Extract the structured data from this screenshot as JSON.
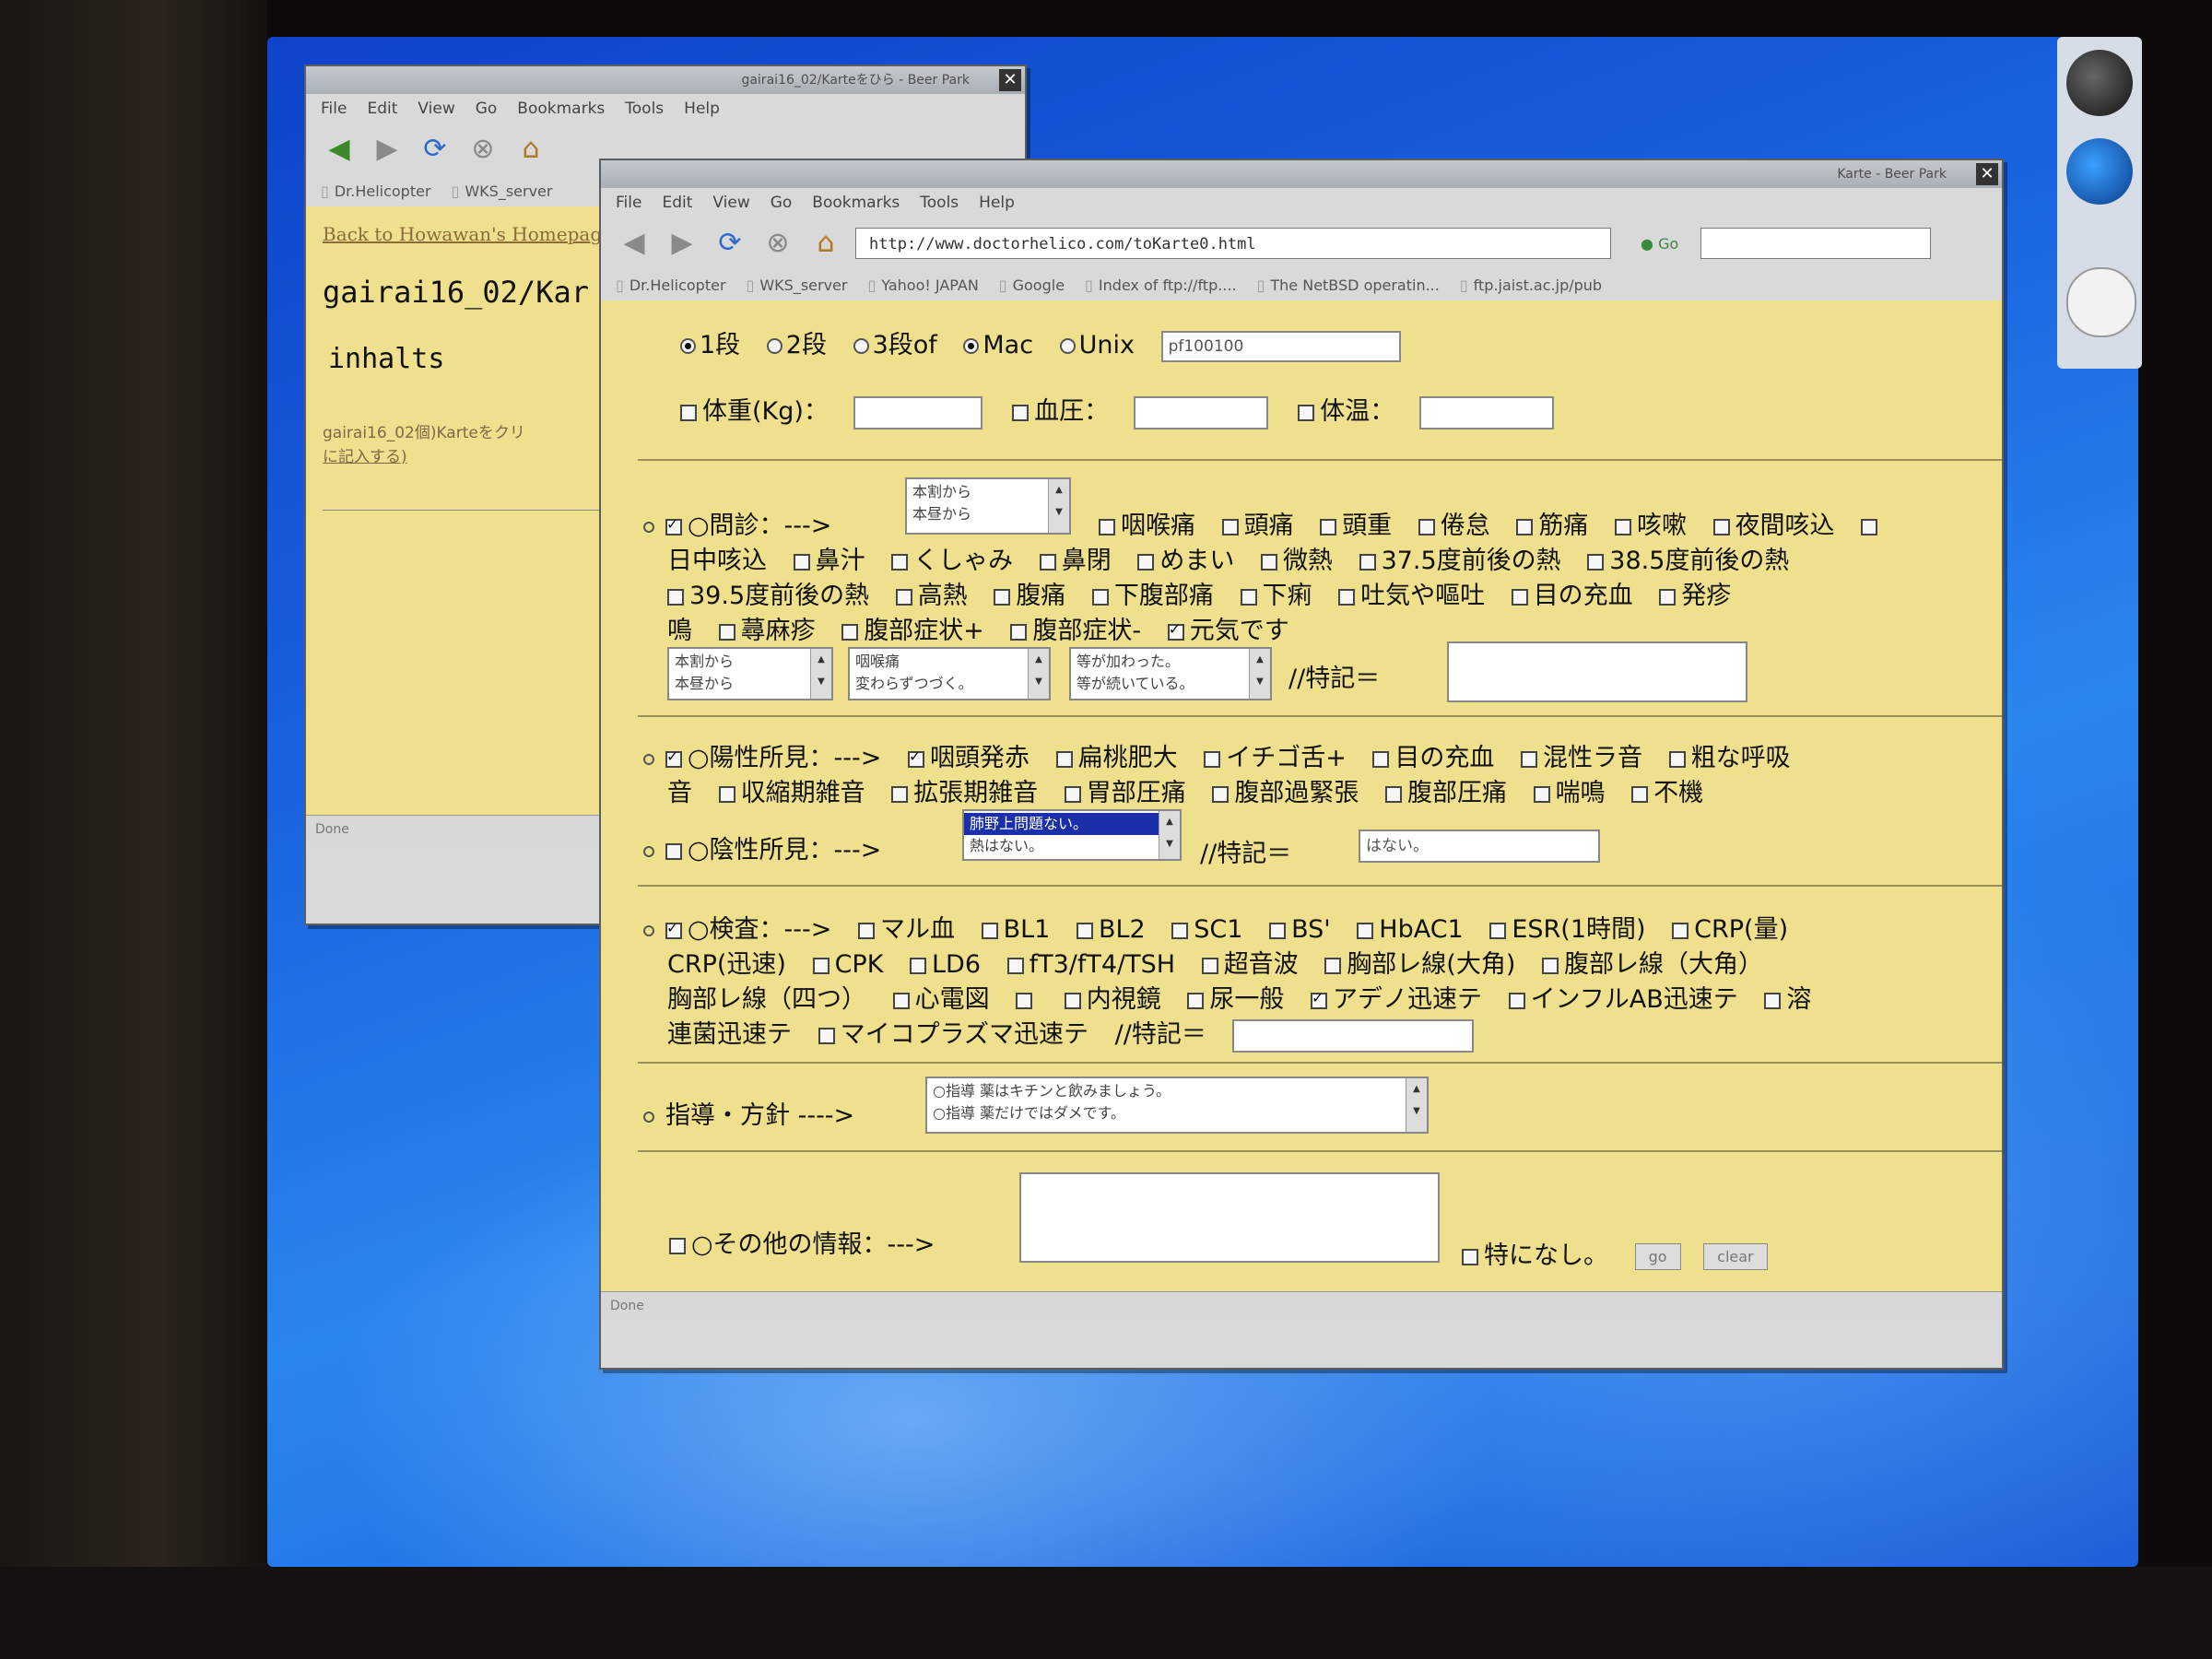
{
  "back_window": {
    "title": "gairai16_02/Karteをひら - Beer Park",
    "menu": [
      "File",
      "Edit",
      "View",
      "Go",
      "Bookmarks",
      "Tools",
      "Help"
    ],
    "bookmarks": [
      "Dr.Helicopter",
      "WKS_server"
    ],
    "link_home": "Back to Howawan's Homepage",
    "heading": "gairai16_02/Kar",
    "heading2": "inhalts",
    "small_text_1": "gairai16_02個)Karteをクリ",
    "small_text_2": "に記入する)",
    "status": "Done"
  },
  "front_window": {
    "title": "Karte - Beer Park",
    "menu": [
      "File",
      "Edit",
      "View",
      "Go",
      "Bookmarks",
      "Tools",
      "Help"
    ],
    "url": "http://www.doctorhelico.com/toKarte0.html",
    "go_label": "Go",
    "bookmarks": [
      "Dr.Helicopter",
      "WKS_server",
      "Yahoo! JAPAN",
      "Google",
      "Index of ftp://ftp....",
      "The NetBSD operatin...",
      "ftp.jaist.ac.jp/pub"
    ],
    "status": "Done"
  },
  "form": {
    "radios": [
      {
        "label": "1段",
        "checked": true
      },
      {
        "label": "2段",
        "checked": false
      },
      {
        "label": "3段of",
        "checked": false
      },
      {
        "label": "Mac",
        "checked": true
      },
      {
        "label": "Unix",
        "checked": false
      }
    ],
    "code_value": "pf100100",
    "vitals": [
      "体重(Kg)：",
      "血圧：",
      "体温："
    ],
    "monshin_label": "○問診：--->",
    "monshin_list": [
      "本割から",
      "本昼から"
    ],
    "monshin_line1": [
      "咽喉痛",
      "頭痛",
      "頭重",
      "倦怠",
      "筋痛",
      "咳嗽",
      "夜間咳込"
    ],
    "monshin_line2": [
      "日中咳込",
      "鼻汁",
      "くしゃみ",
      "鼻閉",
      "めまい",
      "微熱",
      "37.5度前後の熱",
      "38.5度前後の熱"
    ],
    "monshin_line3": [
      "39.5度前後の熱",
      "高熱",
      "腹痛",
      "下腹部痛",
      "下痢",
      "吐気や嘔吐",
      "目の充血",
      "発疹"
    ],
    "monshin_line4_lead": "鳴",
    "monshin_line4": [
      "蕁麻疹",
      "腹部症状+",
      "腹部症状-"
    ],
    "monshin_ok": "元気です",
    "sel1": [
      "本割から",
      "本昼から"
    ],
    "sel2": [
      "咽喉痛",
      "変わらずつづく。"
    ],
    "sel3": [
      "等が加わった。",
      "等が続いている。"
    ],
    "tokki_label": "//特記＝",
    "yousei_label": "○陽性所見：--->",
    "yousei_line1_checked": "咽頭発赤",
    "yousei_line1": [
      "扁桃肥大",
      "イチゴ舌+",
      "目の充血",
      "混性ラ音",
      "粗な呼吸"
    ],
    "yousei_line2_lead": "音",
    "yousei_line2": [
      "収縮期雑音",
      "拡張期雑音",
      "胃部圧痛",
      "腹部過緊張",
      "腹部圧痛",
      "喘鳴",
      "不機"
    ],
    "insei_label": "○陰性所見：--->",
    "insei_list": [
      "肺野上問題ない。",
      "熱はない。"
    ],
    "insei_tokki_value": "はない。",
    "kensa_label": "○検査：--->",
    "kensa_line1": [
      "マル血",
      "BL1",
      "BL2",
      "SC1",
      "BS'",
      "HbAC1",
      "ESR(1時間)",
      "CRP(量)"
    ],
    "kensa_line2": [
      "CRP(迅速)",
      "CPK",
      "LD6",
      "fT3/fT4/TSH",
      "超音波",
      "胸部レ線(大角)",
      "腹部レ線（大角）"
    ],
    "kensa_line3": [
      "胸部レ線（四つ）",
      "心電図",
      "",
      "内視鏡",
      "尿一般"
    ],
    "kensa_line3_checked": "アデノ迅速テ",
    "kensa_line3_end": "インフルAB迅速テ",
    "kensa_line4_lead": "連菌迅速テ",
    "kensa_line4": [
      "マイコプラズマ迅速テ"
    ],
    "kensa_line3_last": "溶",
    "shidou_label": "指導・方針 ---->",
    "shidou_list": [
      "○指導 薬はキチンと飲みましょう。",
      "○指導 薬だけではダメです。"
    ],
    "sonota_label": "○その他の情報：--->",
    "nashi_label": "特になし。",
    "go_btn": "go",
    "clear_btn": "clear"
  }
}
